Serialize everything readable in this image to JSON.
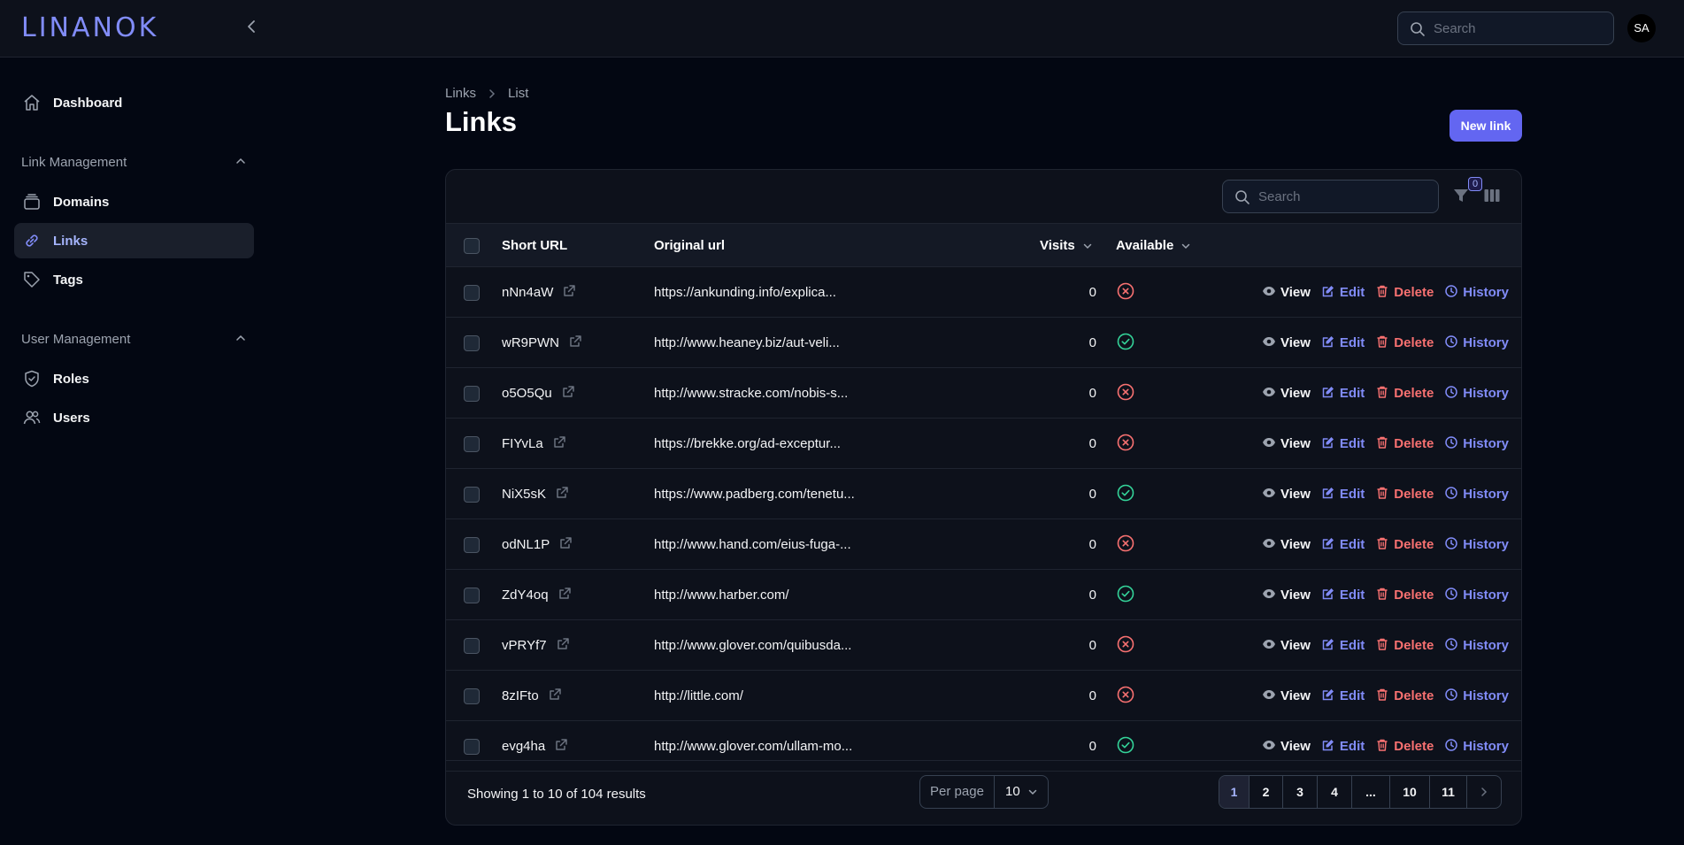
{
  "app": {
    "logo": "LINANOK",
    "avatar_initials": "SA",
    "search_placeholder": "Search"
  },
  "sidebar": {
    "dashboard": "Dashboard",
    "group1": "Link Management",
    "domains": "Domains",
    "links": "Links",
    "tags": "Tags",
    "group2": "User Management",
    "roles": "Roles",
    "users": "Users"
  },
  "breadcrumb": {
    "first": "Links",
    "second": "List"
  },
  "page": {
    "title": "Links",
    "new_button": "New link"
  },
  "table": {
    "search_placeholder": "Search",
    "filter_count": "0",
    "headers": {
      "short": "Short URL",
      "original": "Original url",
      "visits": "Visits",
      "available": "Available"
    },
    "actions": {
      "view": "View",
      "edit": "Edit",
      "delete": "Delete",
      "history": "History"
    },
    "rows": [
      {
        "short": "nNn4aW",
        "original": "https://ankunding.info/explica...",
        "visits": "0",
        "available": false
      },
      {
        "short": "wR9PWN",
        "original": "http://www.heaney.biz/aut-veli...",
        "visits": "0",
        "available": true
      },
      {
        "short": "o5O5Qu",
        "original": "http://www.stracke.com/nobis-s...",
        "visits": "0",
        "available": false
      },
      {
        "short": "FIYvLa",
        "original": "https://brekke.org/ad-exceptur...",
        "visits": "0",
        "available": false
      },
      {
        "short": "NiX5sK",
        "original": "https://www.padberg.com/tenetu...",
        "visits": "0",
        "available": true
      },
      {
        "short": "odNL1P",
        "original": "http://www.hand.com/eius-fuga-...",
        "visits": "0",
        "available": false
      },
      {
        "short": "ZdY4oq",
        "original": "http://www.harber.com/",
        "visits": "0",
        "available": true
      },
      {
        "short": "vPRYf7",
        "original": "http://www.glover.com/quibusda...",
        "visits": "0",
        "available": false
      },
      {
        "short": "8zIFto",
        "original": "http://little.com/",
        "visits": "0",
        "available": false
      },
      {
        "short": "evg4ha",
        "original": "http://www.glover.com/ullam-mo...",
        "visits": "0",
        "available": true
      }
    ]
  },
  "footer": {
    "showing": "Showing 1 to 10 of 104 results",
    "per_page_label": "Per page",
    "per_page_value": "10",
    "pages": [
      "1",
      "2",
      "3",
      "4",
      "...",
      "10",
      "11"
    ],
    "current_page": "1"
  },
  "colors": {
    "accent": "#6366f1",
    "success": "#34d399",
    "danger": "#f87171"
  }
}
